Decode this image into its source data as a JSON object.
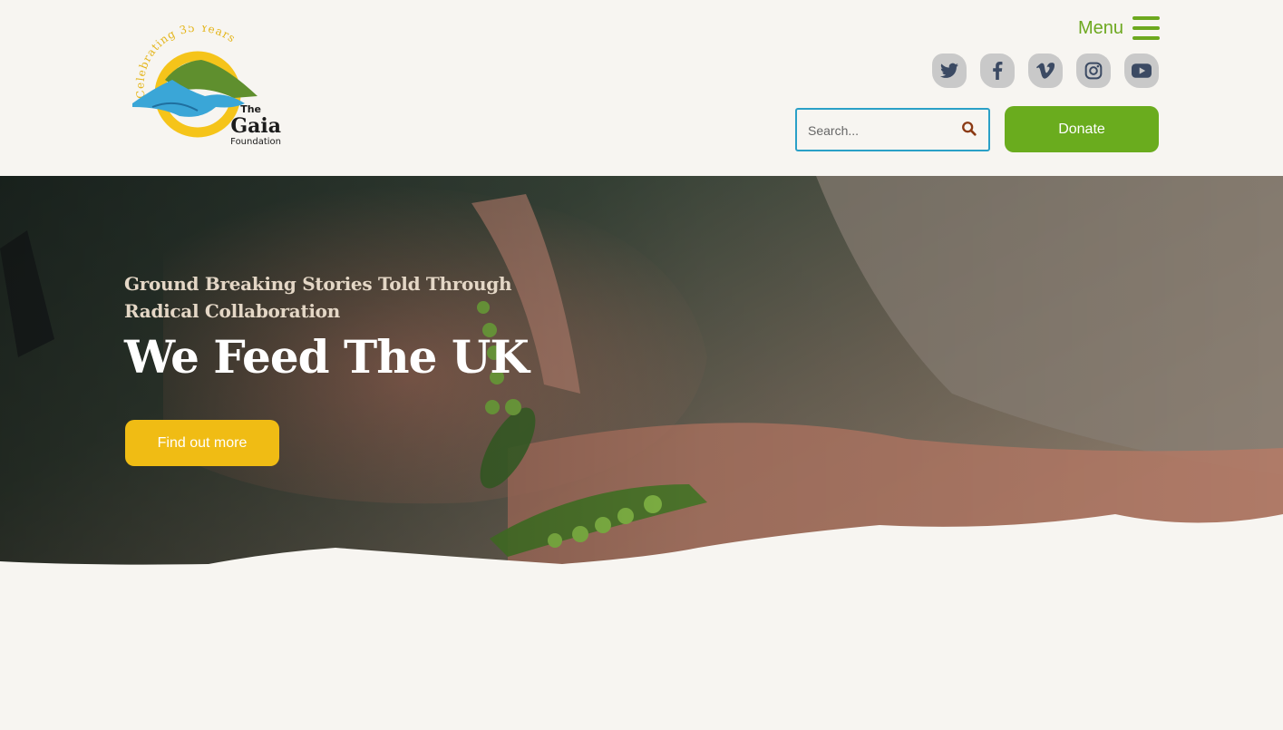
{
  "brand": {
    "logo_ring_text": "Celebrating 35 Years",
    "logo_line1": "The",
    "logo_line2": "Gaia",
    "logo_line3": "Foundation"
  },
  "nav": {
    "menu_label": "Menu"
  },
  "social": [
    {
      "name": "twitter",
      "icon": "twitter-icon"
    },
    {
      "name": "facebook",
      "icon": "facebook-icon"
    },
    {
      "name": "vimeo",
      "icon": "vimeo-icon"
    },
    {
      "name": "instagram",
      "icon": "instagram-icon"
    },
    {
      "name": "youtube",
      "icon": "youtube-icon"
    }
  ],
  "search": {
    "placeholder": "Search...",
    "value": ""
  },
  "actions": {
    "donate_label": "Donate"
  },
  "hero": {
    "kicker": "Ground Breaking Stories Told Through Radical Collaboration",
    "title": "We Feed The UK",
    "cta_label": "Find out more"
  },
  "colors": {
    "page_background": "#f7f5f1",
    "brand_green": "#6aac1e",
    "search_border": "#2aa0c7",
    "cta_yellow": "#f0bc14",
    "social_icon_bg": "#c9c9c9",
    "social_icon_fg": "#3b4a63"
  }
}
